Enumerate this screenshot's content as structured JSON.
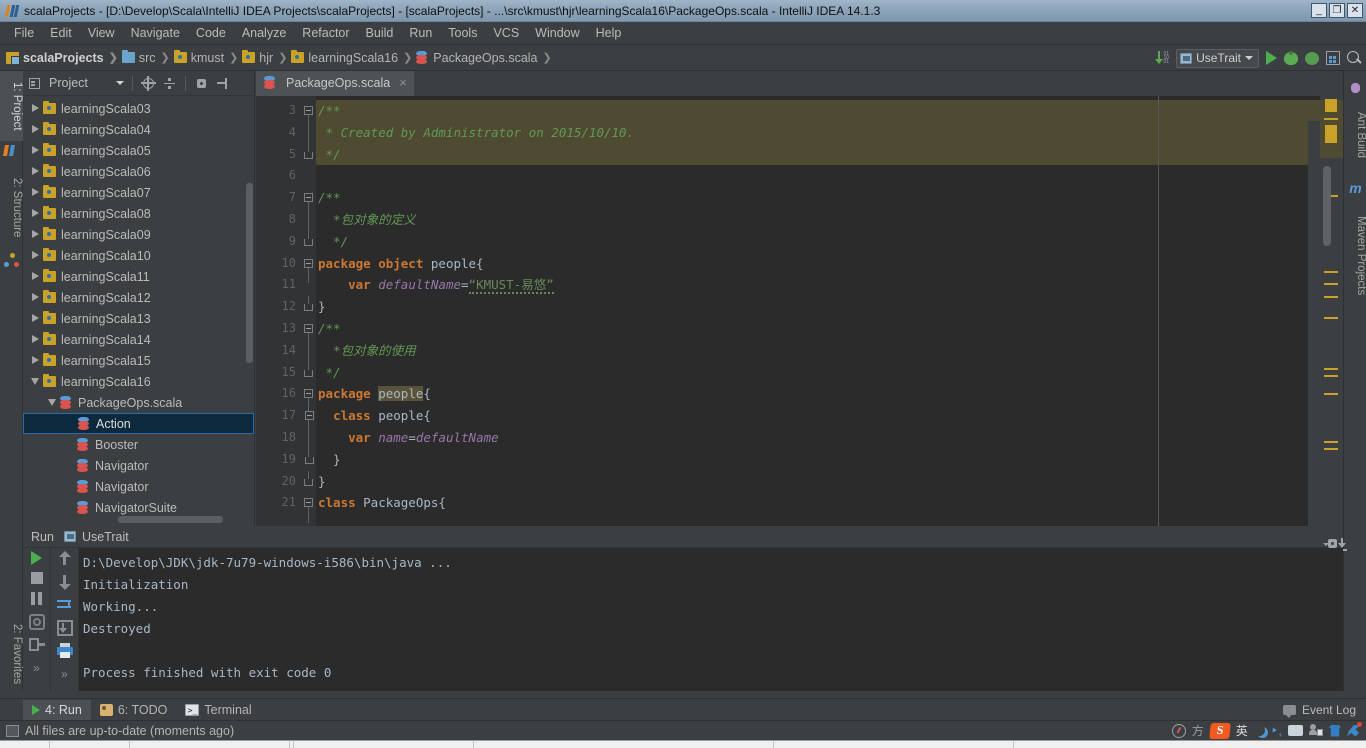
{
  "window": {
    "title": "scalaProjects - [D:\\Develop\\Scala\\IntelliJ IDEA Projects\\scalaProjects] - [scalaProjects] - ...\\src\\kmust\\hjr\\learningScala16\\PackageOps.scala - IntelliJ IDEA 14.1.3",
    "minimize": "_",
    "maximize": "❐",
    "close": "✕"
  },
  "menubar": {
    "items": [
      {
        "label": "File"
      },
      {
        "label": "Edit"
      },
      {
        "label": "View"
      },
      {
        "label": "Navigate"
      },
      {
        "label": "Code"
      },
      {
        "label": "Analyze"
      },
      {
        "label": "Refactor"
      },
      {
        "label": "Build"
      },
      {
        "label": "Run"
      },
      {
        "label": "Tools"
      },
      {
        "label": "VCS"
      },
      {
        "label": "Window"
      },
      {
        "label": "Help"
      }
    ]
  },
  "breadcrumb": {
    "items": [
      {
        "label": "scalaProjects",
        "icon": "project-icon"
      },
      {
        "label": "src",
        "icon": "source-folder-icon"
      },
      {
        "label": "kmust",
        "icon": "package-folder-icon"
      },
      {
        "label": "hjr",
        "icon": "package-folder-icon"
      },
      {
        "label": "learningScala16",
        "icon": "package-folder-icon"
      },
      {
        "label": "PackageOps.scala",
        "icon": "scala-file-icon"
      }
    ]
  },
  "toolbar": {
    "run_configuration": "UseTrait",
    "icons": [
      "download-updates-icon",
      "run-icon",
      "debug-icon",
      "coverage-icon",
      "layout-icon",
      "search-everywhere-icon"
    ]
  },
  "left_tool_tabs": [
    {
      "label": "1: Project",
      "selected": true
    },
    {
      "label": "2: Structure",
      "selected": false
    },
    {
      "label": "2: Favorites",
      "selected": false
    }
  ],
  "right_tool_tabs": [
    {
      "label": "Ant Build",
      "icon": "ant-icon"
    },
    {
      "label": "Maven Projects",
      "icon": "maven-icon"
    }
  ],
  "project_panel": {
    "title": "Project",
    "header_icons": [
      "collapse-target-icon",
      "expand-collapse-icon",
      "settings-gear-icon",
      "hide-panel-icon"
    ],
    "tree": [
      {
        "label": "learningScala03",
        "indent": 2,
        "twist": "collapsed",
        "icon": "package-folder-icon",
        "selected": false
      },
      {
        "label": "learningScala04",
        "indent": 2,
        "twist": "collapsed",
        "icon": "package-folder-icon",
        "selected": false
      },
      {
        "label": "learningScala05",
        "indent": 2,
        "twist": "collapsed",
        "icon": "package-folder-icon",
        "selected": false
      },
      {
        "label": "learningScala06",
        "indent": 2,
        "twist": "collapsed",
        "icon": "package-folder-icon",
        "selected": false
      },
      {
        "label": "learningScala07",
        "indent": 2,
        "twist": "collapsed",
        "icon": "package-folder-icon",
        "selected": false
      },
      {
        "label": "learningScala08",
        "indent": 2,
        "twist": "collapsed",
        "icon": "package-folder-icon",
        "selected": false
      },
      {
        "label": "learningScala09",
        "indent": 2,
        "twist": "collapsed",
        "icon": "package-folder-icon",
        "selected": false
      },
      {
        "label": "learningScala10",
        "indent": 2,
        "twist": "collapsed",
        "icon": "package-folder-icon",
        "selected": false
      },
      {
        "label": "learningScala11",
        "indent": 2,
        "twist": "collapsed",
        "icon": "package-folder-icon",
        "selected": false
      },
      {
        "label": "learningScala12",
        "indent": 2,
        "twist": "collapsed",
        "icon": "package-folder-icon",
        "selected": false
      },
      {
        "label": "learningScala13",
        "indent": 2,
        "twist": "collapsed",
        "icon": "package-folder-icon",
        "selected": false
      },
      {
        "label": "learningScala14",
        "indent": 2,
        "twist": "collapsed",
        "icon": "package-folder-icon",
        "selected": false
      },
      {
        "label": "learningScala15",
        "indent": 2,
        "twist": "collapsed",
        "icon": "package-folder-icon",
        "selected": false
      },
      {
        "label": "learningScala16",
        "indent": 2,
        "twist": "expanded",
        "icon": "package-folder-icon",
        "selected": false
      },
      {
        "label": "PackageOps.scala",
        "indent": 3,
        "twist": "expanded",
        "icon": "scala-file-icon",
        "selected": false
      },
      {
        "label": "Action",
        "indent": 4,
        "twist": "none",
        "icon": "scala-class-icon",
        "selected": true
      },
      {
        "label": "Booster",
        "indent": 4,
        "twist": "none",
        "icon": "scala-class-icon",
        "selected": false
      },
      {
        "label": "Navigator",
        "indent": 4,
        "twist": "none",
        "icon": "scala-class-icon",
        "selected": false
      },
      {
        "label": "Navigator",
        "indent": 4,
        "twist": "none",
        "icon": "scala-class-icon",
        "selected": false
      },
      {
        "label": "NavigatorSuite",
        "indent": 4,
        "twist": "none",
        "icon": "scala-class-icon",
        "selected": false
      }
    ]
  },
  "editor": {
    "tab": {
      "label": "PackageOps.scala",
      "close": "×",
      "icon": "scala-file-icon"
    },
    "first_line_number": 3,
    "lines": [
      {
        "n": 3,
        "highlight": true,
        "fold": "start",
        "tokens": [
          {
            "t": "/**",
            "c": "comment"
          }
        ]
      },
      {
        "n": 4,
        "highlight": true,
        "fold": "bar",
        "tokens": [
          {
            "t": " * Created by Administrator on 2015/10/10.",
            "c": "comment"
          }
        ]
      },
      {
        "n": 5,
        "highlight": true,
        "fold": "end",
        "tokens": [
          {
            "t": " */",
            "c": "comment"
          }
        ]
      },
      {
        "n": 6,
        "highlight": false,
        "fold": "none",
        "tokens": []
      },
      {
        "n": 7,
        "highlight": false,
        "fold": "start",
        "tokens": [
          {
            "t": "/**",
            "c": "comment"
          }
        ]
      },
      {
        "n": 8,
        "highlight": false,
        "fold": "bar",
        "tokens": [
          {
            "t": "  *包对象的定义",
            "c": "comment"
          }
        ]
      },
      {
        "n": 9,
        "highlight": false,
        "fold": "end",
        "tokens": [
          {
            "t": "  */",
            "c": "comment"
          }
        ]
      },
      {
        "n": 10,
        "highlight": false,
        "fold": "start",
        "tokens": [
          {
            "t": "package object ",
            "c": "kw"
          },
          {
            "t": "people{",
            "c": "plain"
          }
        ]
      },
      {
        "n": 11,
        "highlight": false,
        "fold": "none",
        "tokens": [
          {
            "t": "    ",
            "c": "plain"
          },
          {
            "t": "var ",
            "c": "kw"
          },
          {
            "t": "defaultName",
            "c": "field"
          },
          {
            "t": "=",
            "c": "plain"
          },
          {
            "t": "“KMUST-易悠”",
            "c": "str-squiggle"
          }
        ]
      },
      {
        "n": 12,
        "highlight": false,
        "fold": "end",
        "tokens": [
          {
            "t": "}",
            "c": "plain"
          }
        ]
      },
      {
        "n": 13,
        "highlight": false,
        "fold": "start",
        "tokens": [
          {
            "t": "/**",
            "c": "comment"
          }
        ]
      },
      {
        "n": 14,
        "highlight": false,
        "fold": "bar",
        "tokens": [
          {
            "t": "  *包对象的使用",
            "c": "comment"
          }
        ]
      },
      {
        "n": 15,
        "highlight": false,
        "fold": "end",
        "tokens": [
          {
            "t": " */",
            "c": "comment"
          }
        ]
      },
      {
        "n": 16,
        "highlight": false,
        "fold": "start",
        "tokens": [
          {
            "t": "package ",
            "c": "kw"
          },
          {
            "t": "people",
            "c": "hl-token"
          },
          {
            "t": "{",
            "c": "plain"
          }
        ]
      },
      {
        "n": 17,
        "highlight": false,
        "fold": "start2",
        "tokens": [
          {
            "t": "  ",
            "c": "plain"
          },
          {
            "t": "class ",
            "c": "kw"
          },
          {
            "t": "people{",
            "c": "plain"
          }
        ]
      },
      {
        "n": 18,
        "highlight": false,
        "fold": "bar2",
        "tokens": [
          {
            "t": "    ",
            "c": "plain"
          },
          {
            "t": "var ",
            "c": "kw"
          },
          {
            "t": "name",
            "c": "field"
          },
          {
            "t": "=",
            "c": "plain"
          },
          {
            "t": "defaultName",
            "c": "field"
          }
        ]
      },
      {
        "n": 19,
        "highlight": false,
        "fold": "end2",
        "tokens": [
          {
            "t": "  }",
            "c": "plain"
          }
        ]
      },
      {
        "n": 20,
        "highlight": false,
        "fold": "end",
        "tokens": [
          {
            "t": "}",
            "c": "plain"
          }
        ]
      },
      {
        "n": 21,
        "highlight": false,
        "fold": "start",
        "tokens": [
          {
            "t": "class ",
            "c": "kw"
          },
          {
            "t": "PackageOps{",
            "c": "plain"
          }
        ]
      }
    ]
  },
  "run_window": {
    "title": "Run",
    "tab_label": "UseTrait",
    "left_icons": [
      "rerun-icon",
      "stop-icon",
      "pause-icon",
      "dump-threads-icon",
      "restore-layout-icon",
      "expand-more-icon"
    ],
    "second_icons": [
      "scroll-up-icon",
      "scroll-down-icon",
      "soft-wrap-icon",
      "export-icon",
      "print-icon",
      "expand-more-icon"
    ],
    "header_icons": [
      "settings-gear-icon",
      "hide-window-icon"
    ],
    "console_lines": [
      {
        "text": "D:\\Develop\\JDK\\jdk-7u79-windows-i586\\bin\\java ...",
        "kind": "command"
      },
      {
        "text": "Initialization",
        "kind": "output"
      },
      {
        "text": "Working...",
        "kind": "output"
      },
      {
        "text": "Destroyed",
        "kind": "output"
      },
      {
        "text": "",
        "kind": "output"
      },
      {
        "text": "Process finished with exit code 0",
        "kind": "output"
      }
    ]
  },
  "bottom_tabs": [
    {
      "label": "4: Run",
      "selected": true,
      "icon": "run-icon"
    },
    {
      "label": "6: TODO",
      "selected": false,
      "icon": "todo-icon"
    },
    {
      "label": "Terminal",
      "selected": false,
      "icon": "terminal-icon"
    }
  ],
  "bottom_right": {
    "label": "Event Log",
    "icon": "event-log-icon"
  },
  "statusbar": {
    "message": "All files are up-to-date (moments ago)",
    "icon": "vcs-up-to-date-icon",
    "tray": [
      "gauge-icon",
      "sogou-icon",
      "chinese-input-icon",
      "moon-icon",
      "comma-icon",
      "keyboard-icon",
      "user-icon",
      "skin-icon",
      "wrench-icon"
    ],
    "tray_chinese": "英"
  },
  "colors": {
    "accent_orange": "#cc7832",
    "comment_green": "#629755",
    "string_green": "#6a8759",
    "field_purple": "#9876aa",
    "plain_text": "#a9b7c6",
    "editor_bg": "#2b2b2b",
    "panel_bg": "#3c3f41",
    "selection_blue": "#0d293e",
    "highlight_olive": "#4f4b33",
    "marker_yellow": "#c9a227",
    "run_green": "#4caf50"
  }
}
